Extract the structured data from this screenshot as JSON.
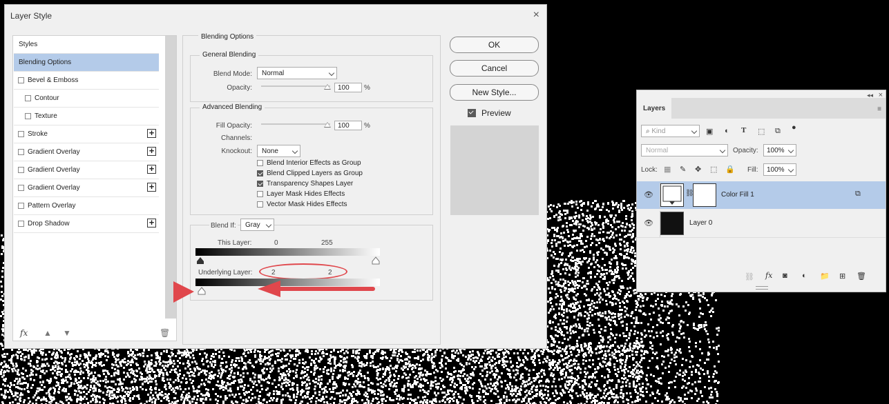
{
  "dialog": {
    "title": "Layer Style",
    "close_glyph": "×",
    "styles_header": "Styles",
    "styles_list": [
      {
        "label": "Blending Options",
        "checkbox": false,
        "selected": true,
        "plus": false,
        "indent": false
      },
      {
        "label": "Bevel & Emboss",
        "checkbox": true,
        "checked": false,
        "plus": false,
        "indent": false
      },
      {
        "label": "Contour",
        "checkbox": true,
        "checked": false,
        "plus": false,
        "indent": true
      },
      {
        "label": "Texture",
        "checkbox": true,
        "checked": false,
        "plus": false,
        "indent": true
      },
      {
        "label": "Stroke",
        "checkbox": true,
        "checked": false,
        "plus": true,
        "indent": false
      },
      {
        "label": "Gradient Overlay",
        "checkbox": true,
        "checked": false,
        "plus": true,
        "indent": false
      },
      {
        "label": "Gradient Overlay",
        "checkbox": true,
        "checked": false,
        "plus": true,
        "indent": false
      },
      {
        "label": "Gradient Overlay",
        "checkbox": true,
        "checked": false,
        "plus": true,
        "indent": false
      },
      {
        "label": "Pattern Overlay",
        "checkbox": true,
        "checked": false,
        "plus": false,
        "indent": false
      },
      {
        "label": "Drop Shadow",
        "checkbox": true,
        "checked": false,
        "plus": true,
        "indent": false
      }
    ],
    "fx_label": "fx",
    "blending_options_title": "Blending Options",
    "general_blending": {
      "title": "General Blending",
      "blend_mode_label": "Blend Mode:",
      "blend_mode_value": "Normal",
      "opacity_label": "Opacity:",
      "opacity_value": "100",
      "opacity_unit": "%"
    },
    "advanced_blending": {
      "title": "Advanced Blending",
      "fill_opacity_label": "Fill Opacity:",
      "fill_opacity_value": "100",
      "fill_opacity_unit": "%",
      "channels_label": "Channels:",
      "knockout_label": "Knockout:",
      "knockout_value": "None",
      "options": [
        {
          "label": "Blend Interior Effects as Group",
          "checked": false
        },
        {
          "label": "Blend Clipped Layers as Group",
          "checked": true
        },
        {
          "label": "Transparency Shapes Layer",
          "checked": true
        },
        {
          "label": "Layer Mask Hides Effects",
          "checked": false
        },
        {
          "label": "Vector Mask Hides Effects",
          "checked": false
        }
      ]
    },
    "blend_if": {
      "label": "Blend If:",
      "value": "Gray",
      "this_layer_label": "This Layer:",
      "this_layer_low": "0",
      "this_layer_high": "255",
      "underlying_label": "Underlying Layer:",
      "underlying_low": "2",
      "underlying_high": "2"
    },
    "buttons": {
      "ok": "OK",
      "cancel": "Cancel",
      "new_style": "New Style...",
      "preview": "Preview",
      "preview_checked": true
    }
  },
  "layers_panel": {
    "tab_label": "Layers",
    "kind_placeholder": "Kind",
    "blend_mode": "Normal",
    "opacity_label": "Opacity:",
    "opacity_value": "100%",
    "lock_label": "Lock:",
    "fill_label": "Fill:",
    "fill_value": "100%",
    "layers": [
      {
        "name": "Color Fill 1",
        "selected": true,
        "visible": true
      },
      {
        "name": "Layer 0",
        "selected": false,
        "visible": true
      }
    ],
    "footer_fx": "fx"
  },
  "colors": {
    "selection": "#b4cbe9",
    "annotation_red": "#e0474c"
  }
}
